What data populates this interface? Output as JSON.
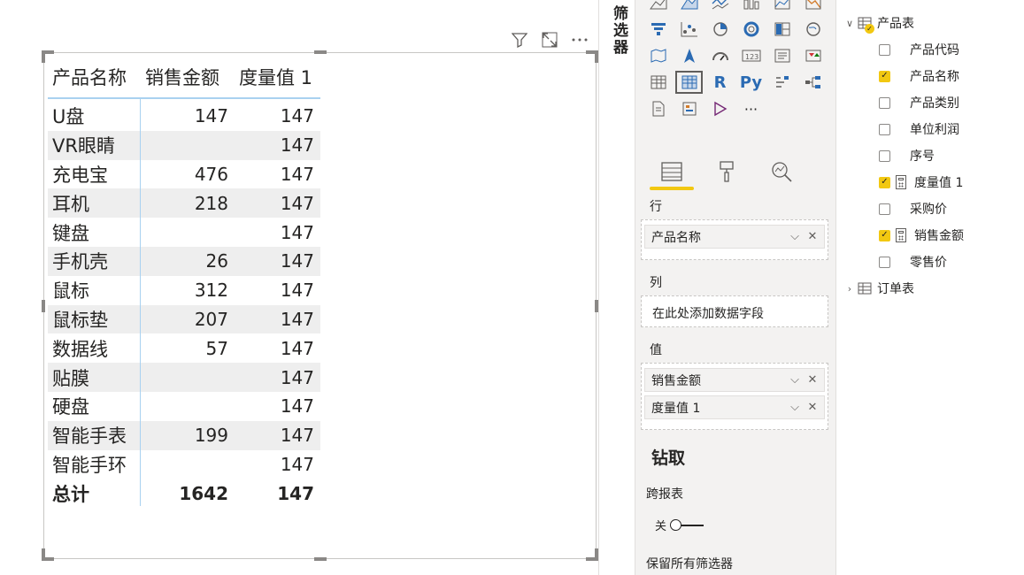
{
  "visual": {
    "columns": [
      "产品名称",
      "销售金额",
      "度量值 1"
    ],
    "rows": [
      {
        "name": "U盘",
        "sales": "147",
        "measure": "147"
      },
      {
        "name": "VR眼睛",
        "sales": "",
        "measure": "147"
      },
      {
        "name": "充电宝",
        "sales": "476",
        "measure": "147"
      },
      {
        "name": "耳机",
        "sales": "218",
        "measure": "147"
      },
      {
        "name": "键盘",
        "sales": "",
        "measure": "147"
      },
      {
        "name": "手机壳",
        "sales": "26",
        "measure": "147"
      },
      {
        "name": "鼠标",
        "sales": "312",
        "measure": "147"
      },
      {
        "name": "鼠标垫",
        "sales": "207",
        "measure": "147"
      },
      {
        "name": "数据线",
        "sales": "57",
        "measure": "147"
      },
      {
        "name": "贴膜",
        "sales": "",
        "measure": "147"
      },
      {
        "name": "硬盘",
        "sales": "",
        "measure": "147"
      },
      {
        "name": "智能手表",
        "sales": "199",
        "measure": "147"
      },
      {
        "name": "智能手环",
        "sales": "",
        "measure": "147"
      }
    ],
    "total": {
      "name": "总计",
      "sales": "1642",
      "measure": "147"
    },
    "header_icons": [
      "filter-icon",
      "focus-mode-icon",
      "more-options-icon"
    ]
  },
  "filters_pane": {
    "label": "筛选器"
  },
  "visualizations": {
    "icons": [
      [
        "area-chart-icon",
        "stacked-area-icon",
        "line-clustered-icon",
        "ribbon-icon",
        "waterfall-icon",
        "funnel-icon",
        "scatter-icon"
      ],
      [
        "column-icon",
        "funnel-icon",
        "scatter-icon",
        "pie-icon",
        "donut-icon",
        "treemap-icon",
        "map-icon"
      ],
      [
        "globe-icon",
        "filled-map-icon",
        "shape-map-icon",
        "azure-map-icon",
        "gauge-icon",
        "card-icon",
        "multi-row-card-icon"
      ],
      [
        "kpi-icon",
        "slicer-icon",
        "table-icon",
        "matrix-icon",
        "r-visual-icon",
        "python-icon",
        "key-influencers-icon"
      ],
      [
        "decomposition-tree-icon",
        "qa-icon",
        "smart-narrative-icon",
        "paginated-icon",
        "power-apps-icon",
        "more-icon"
      ]
    ],
    "r_label": "R",
    "py_label": "Py",
    "more_label": "···",
    "tabs": [
      "fields-tab-icon",
      "format-tab-icon",
      "analytics-tab-icon"
    ],
    "rows_label": "行",
    "rows_field": "产品名称",
    "columns_label": "列",
    "columns_placeholder": "在此处添加数据字段",
    "values_label": "值",
    "values_fields": [
      "销售金额",
      "度量值 1"
    ],
    "drill_title": "钻取",
    "cross_report_label": "跨报表",
    "toggle_state": "关",
    "keep_filters_label": "保留所有筛选器"
  },
  "fields": {
    "tables": [
      {
        "name": "产品表",
        "expanded": true,
        "fields": [
          {
            "name": "产品代码",
            "checked": false,
            "measure": false
          },
          {
            "name": "产品名称",
            "checked": true,
            "measure": false
          },
          {
            "name": "产品类别",
            "checked": false,
            "measure": false
          },
          {
            "name": "单位利润",
            "checked": false,
            "measure": false
          },
          {
            "name": "序号",
            "checked": false,
            "measure": false
          },
          {
            "name": "度量值 1",
            "checked": true,
            "measure": true
          },
          {
            "name": "采购价",
            "checked": false,
            "measure": false
          },
          {
            "name": "销售金额",
            "checked": true,
            "measure": true
          },
          {
            "name": "零售价",
            "checked": false,
            "measure": false
          }
        ]
      },
      {
        "name": "订单表",
        "expanded": false,
        "fields": []
      }
    ]
  },
  "colors": {
    "accent": "#f2c811",
    "divider": "#a9d1f0",
    "alt_row": "#eeeeee"
  }
}
